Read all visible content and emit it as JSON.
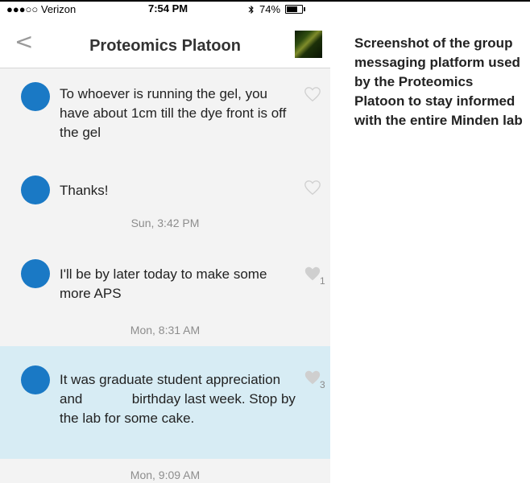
{
  "status_bar": {
    "carrier": "●●●○○ Verizon",
    "time": "7:54 PM",
    "battery": "74%"
  },
  "nav": {
    "back_icon": "chevron-left-icon",
    "title": "Proteomics Platoon"
  },
  "messages": [
    {
      "text": "To whoever is running the gel, you have about 1cm till the dye front is off the gel",
      "likes": ""
    },
    {
      "text": "Thanks!",
      "likes": ""
    },
    {
      "text": "I'll be by later today to make some more APS",
      "likes": "1"
    },
    {
      "text": "It was graduate student appreciation and             birthday last week. Stop by the lab for some cake.",
      "likes": "3"
    }
  ],
  "timestamps": [
    "Sun, 3:42 PM",
    "Mon, 8:31 AM",
    "Mon, 9:09 AM"
  ],
  "caption": "Screenshot of the group messaging platform used by the Proteomics Platoon to stay informed with the entire Minden lab",
  "colors": {
    "avatar_blue": "#1a79c5",
    "highlight_row": "#d7ecf4",
    "background": "#f3f3f3"
  }
}
